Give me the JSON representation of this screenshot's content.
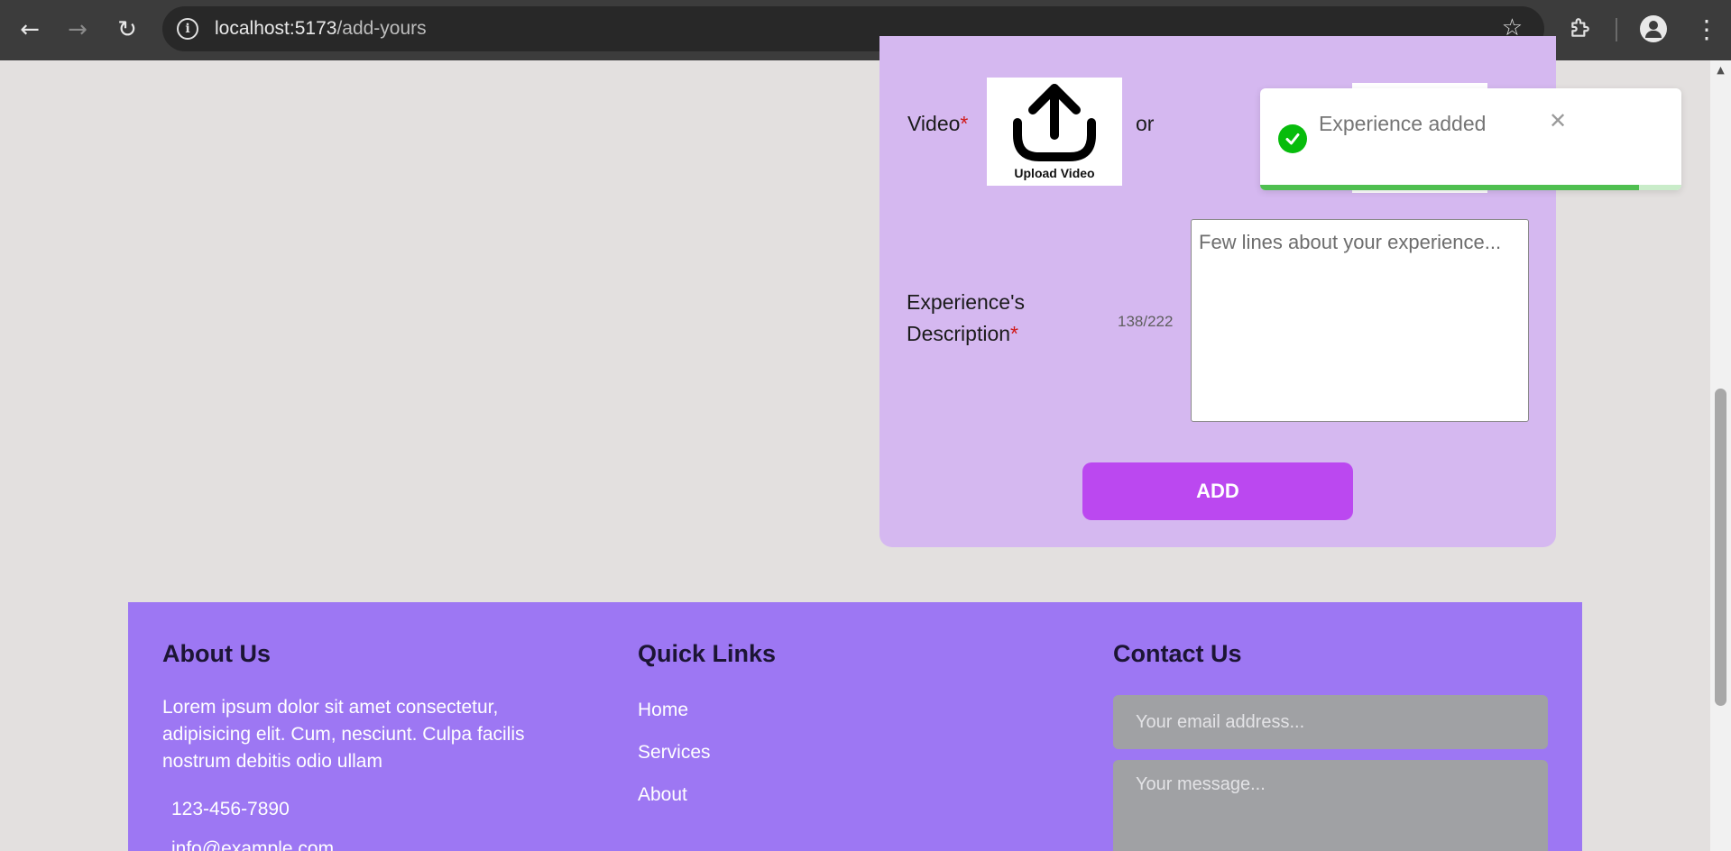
{
  "browser": {
    "url_host": "localhost:5173",
    "url_path": "/add-yours"
  },
  "form": {
    "video_label": "Video",
    "required_mark": "*",
    "upload_caption": "Upload Video",
    "or_text": "or",
    "description_label_line1": "Experience's",
    "description_label_line2": "Description",
    "char_counter": "138/222",
    "description_placeholder": "Few lines about your experience...",
    "add_button": "ADD"
  },
  "toast": {
    "message": "Experience added",
    "close_symbol": "✕",
    "progress": 0.9,
    "color": "#07bc0c"
  },
  "footer": {
    "about_heading": "About Us",
    "about_text": "Lorem ipsum dolor sit amet consectetur, adipisicing elit. Cum, nesciunt. Culpa facilis nostrum debitis odio ullam",
    "phone": "123-456-7890",
    "email": "info@example.com",
    "links_heading": "Quick Links",
    "links": [
      "Home",
      "Services",
      "About"
    ],
    "contact_heading": "Contact Us",
    "email_placeholder": "Your email address...",
    "message_placeholder": "Your message..."
  },
  "colors": {
    "page_bg": "#e3e0df",
    "card_bg": "#d5b8f0",
    "button_bg": "#bb48f0",
    "footer_bg": "#9d77f3"
  },
  "icons": [
    "back-arrow-icon",
    "forward-arrow-icon",
    "reload-icon",
    "info-icon",
    "star-icon",
    "extensions-icon",
    "profile-icon",
    "menu-icon",
    "upload-icon",
    "check-icon",
    "close-icon"
  ]
}
